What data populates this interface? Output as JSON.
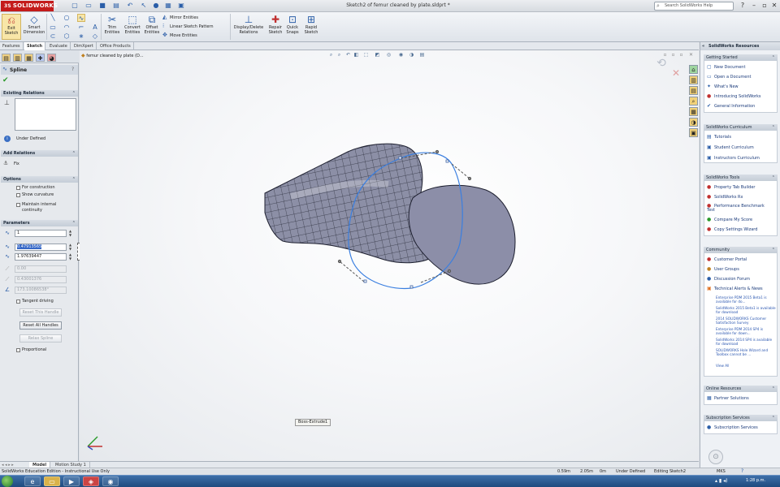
{
  "titlebar": {
    "logo": "SOLIDWORKS",
    "logo_prefix": "3S",
    "document_title": "Sketch2 of femur cleaned by plate.sldprt *",
    "search_placeholder": "Search SolidWorks Help"
  },
  "ribbon": {
    "exit_sketch": [
      "Exit",
      "Sketch"
    ],
    "smart_dimension": [
      "Smart",
      "Dimension"
    ],
    "trim_entities": [
      "Trim",
      "Entities"
    ],
    "convert_entities": [
      "Convert",
      "Entities"
    ],
    "offset_entities": [
      "Offset",
      "Entities"
    ],
    "mirror_entities": "Mirror Entities",
    "linear_sketch_pattern": "Linear Sketch Pattern",
    "move_entities": "Move Entities",
    "display_delete_relations": [
      "Display/Delete",
      "Relations"
    ],
    "repair_sketch": [
      "Repair",
      "Sketch"
    ],
    "quick_snaps": [
      "Quick",
      "Snaps"
    ],
    "rapid_sketch": [
      "Rapid",
      "Sketch"
    ]
  },
  "tabs": [
    "Features",
    "Sketch",
    "Evaluate",
    "DimXpert",
    "Office Products"
  ],
  "active_tab": "Sketch",
  "property_manager": {
    "title": "Spline",
    "existing_relations": {
      "header": "Existing Relations",
      "status": "Under Defined"
    },
    "add_relations": {
      "header": "Add Relations",
      "item": "Fix"
    },
    "options": {
      "header": "Options",
      "for_construction": "For construction",
      "show_curvature": "Show curvature",
      "maintain_continuity": [
        "Maintain internal",
        "continuity"
      ]
    },
    "parameters": {
      "header": "Parameters",
      "point_number": "1",
      "x_value": "0.47913565",
      "y_value": "1.97639447",
      "disabled_1": "0.00",
      "disabled_2": "0.43001376",
      "angle": "173.10086538°",
      "tangent_driving": "Tangent driving",
      "reset_this_handle": "Reset This Handle",
      "reset_all_handles": "Reset All Handles",
      "relax_spline": "Relax Spline",
      "proportional": "Proportional"
    }
  },
  "graphics": {
    "tree_root": "femur cleaned by plate  (D...",
    "tooltip": "Boss-Extrude1"
  },
  "bottom_tabs": [
    "Model",
    "Motion Study 1"
  ],
  "status_bar": {
    "edition": "SolidWorks Education Edition - Instructional Use Only",
    "x": "0.59m",
    "y": "2.05m",
    "z": "0m",
    "state": "Under Defined",
    "editing": "Editing Sketch2",
    "units": "MKS"
  },
  "task_pane": {
    "title": "SolidWorks Resources",
    "getting_started": {
      "header": "Getting Started",
      "items": [
        "New Document",
        "Open a Document",
        "What's New",
        "Introducing SolidWorks",
        "General Information"
      ]
    },
    "curriculum": {
      "header": "SolidWorks Curriculum",
      "items": [
        "Tutorials",
        "Student Curriculum",
        "Instructors Curriculum"
      ]
    },
    "tools": {
      "header": "SolidWorks Tools",
      "items": [
        "Property Tab Builder",
        "SolidWorks Rx",
        "Performance Benchmark Test",
        "Compare My Score",
        "Copy Settings Wizard"
      ]
    },
    "community": {
      "header": "Community",
      "items": [
        "Customer Portal",
        "User Groups",
        "Discussion Forum",
        "Technical Alerts & News"
      ],
      "news": [
        "Enterprise PDM 2015 Beta1 is available for do...",
        "SolidWorks 2015 Beta1 is available for download",
        "2014 SOLIDWORKS Customer Satisfaction Survey",
        "Enterprise PDM 2014 SP4 is available for down...",
        "SolidWorks 2014 SP4 is available for download",
        "SOLIDWORKS Hole Wizard and Toolbox cannot be ..."
      ],
      "view_all": "View All"
    },
    "online": {
      "header": "Online Resources",
      "items": [
        "Partner Solutions"
      ]
    },
    "subscription": {
      "header": "Subscription Services",
      "items": [
        "Subscription Services"
      ]
    }
  },
  "taskbar": {
    "clock": "1:28 p.m."
  }
}
